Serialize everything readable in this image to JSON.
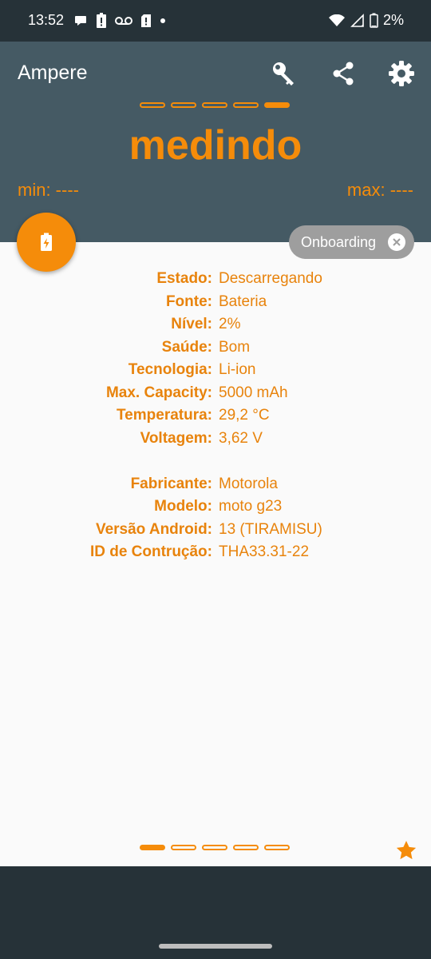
{
  "status_bar": {
    "time": "13:52",
    "battery_percent": "2%"
  },
  "app_bar": {
    "title": "Ampere",
    "actions": [
      "key-icon",
      "share-icon",
      "settings-icon"
    ]
  },
  "measure": {
    "value": "medindo",
    "min": "min: ----",
    "max": "max: ----",
    "top_pager_active_index": 4,
    "top_pager_count": 5
  },
  "chip": {
    "label": "Onboarding"
  },
  "battery_info": [
    {
      "label": "Estado:",
      "value": "Descarregando"
    },
    {
      "label": "Fonte:",
      "value": "Bateria"
    },
    {
      "label": "Nível:",
      "value": "2%"
    },
    {
      "label": "Saúde:",
      "value": "Bom"
    },
    {
      "label": "Tecnologia:",
      "value": "Li-ion"
    },
    {
      "label": "Max. Capacity:",
      "value": "5000 mAh"
    },
    {
      "label": "Temperatura:",
      "value": "29,2 °C"
    },
    {
      "label": "Voltagem:",
      "value": "3,62 V"
    }
  ],
  "device_info": [
    {
      "label": "Fabricante:",
      "value": "Motorola"
    },
    {
      "label": "Modelo:",
      "value": "moto g23"
    },
    {
      "label": "Versão Android:",
      "value": "13 (TIRAMISU)"
    },
    {
      "label": "ID de Contrução:",
      "value": "THA33.31-22"
    }
  ],
  "bottom_pager": {
    "active_index": 0,
    "count": 5
  },
  "colors": {
    "accent": "#F58C0A",
    "app_bar": "#455A64",
    "status_bar": "#263238",
    "background": "#FAFAFA"
  }
}
